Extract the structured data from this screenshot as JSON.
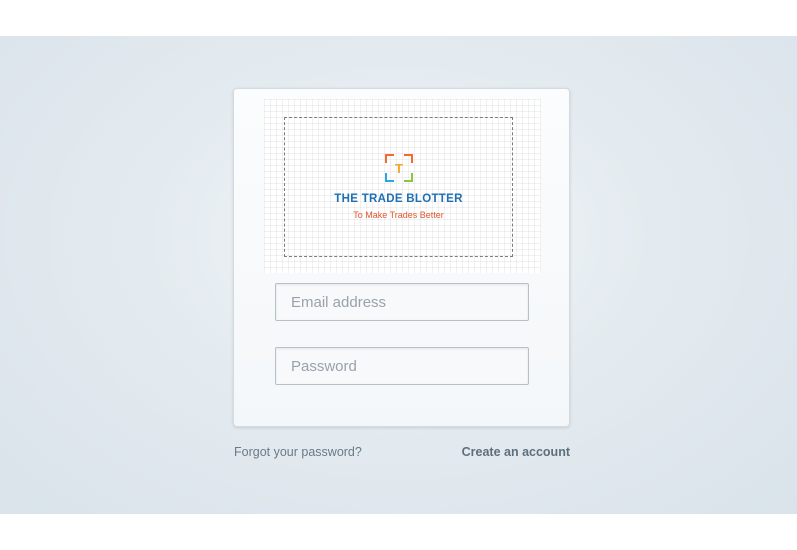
{
  "logo": {
    "title": "THE TRADE BLOTTER",
    "tagline": "To Make Trades Better",
    "mark_letter": "T",
    "colors": {
      "title": "#1e6fb3",
      "tagline": "#e4572e",
      "bracket_orange": "#f26c2f",
      "bracket_green": "#8cc63f",
      "bracket_blue": "#29a8e0",
      "letter": "#f5a623"
    }
  },
  "form": {
    "email_placeholder": "Email address",
    "password_placeholder": "Password"
  },
  "links": {
    "forgot_password": "Forgot your password?",
    "create_account": "Create an account"
  }
}
